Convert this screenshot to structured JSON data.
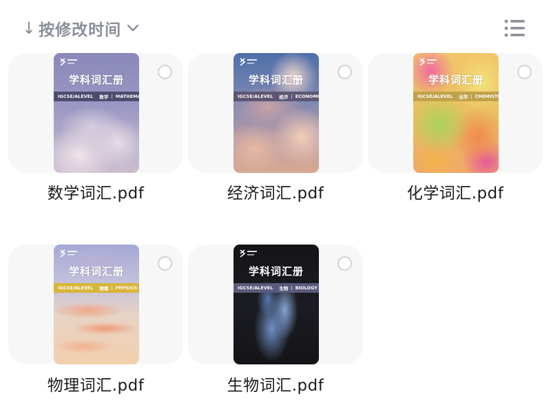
{
  "toolbar": {
    "sort_arrow": "↓",
    "sort_label": "按修改时间",
    "sort_icon": "chevron-down-icon",
    "view_icon": "list-view-icon"
  },
  "colors": {
    "card_bg": "#f7f7f8",
    "muted_text": "#8a8f99",
    "file_name_text": "#1b1b1b"
  },
  "files": [
    {
      "name": "数学词汇.pdf",
      "cover": {
        "title": "学科词汇册",
        "level": "IGCSE/ALEVEL",
        "subject_cn": "数学",
        "subject_en": "MATHEMATICS"
      }
    },
    {
      "name": "经济词汇.pdf",
      "cover": {
        "title": "学科词汇册",
        "level": "IGCSE/ALEVEL",
        "subject_cn": "经济",
        "subject_en": "ECONOMIC"
      }
    },
    {
      "name": "化学词汇.pdf",
      "cover": {
        "title": "学科词汇册",
        "level": "IGCSE/ALEVEL",
        "subject_cn": "化学",
        "subject_en": "CHEMISTRY"
      }
    },
    {
      "name": "物理词汇.pdf",
      "cover": {
        "title": "学科词汇册",
        "level": "IGCSE/ALEVEL",
        "subject_cn": "物理",
        "subject_en": "PHYSICS"
      }
    },
    {
      "name": "生物词汇.pdf",
      "cover": {
        "title": "学科词汇册",
        "level": "IGCSE/ALEVEL",
        "subject_cn": "生物",
        "subject_en": "BIOLOGY"
      }
    }
  ]
}
